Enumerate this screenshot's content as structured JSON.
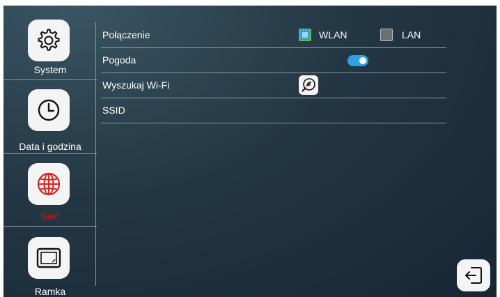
{
  "sidebar": {
    "items": [
      {
        "label": "System",
        "icon": "gear-icon"
      },
      {
        "label": "Data i godzina",
        "icon": "clock-icon"
      },
      {
        "label": "Sieć",
        "icon": "globe-icon",
        "active": true
      },
      {
        "label": "Ramka",
        "icon": "frame-icon"
      }
    ]
  },
  "settings": {
    "connection": {
      "label": "Połączenie",
      "options": [
        "WLAN",
        "LAN"
      ],
      "selected": "WLAN"
    },
    "weather": {
      "label": "Pogoda",
      "enabled": true
    },
    "wifi_search": {
      "label": "Wyszukaj Wi-Fi"
    },
    "ssid": {
      "label": "SSID",
      "value": ""
    }
  },
  "exit": {
    "icon": "exit-icon"
  },
  "colors": {
    "active_nav": "#d41414",
    "accent": "#2f9fe6",
    "checkbox_border": "#5fbf3f",
    "globe": "#d42424",
    "background": "#1c2c38"
  }
}
